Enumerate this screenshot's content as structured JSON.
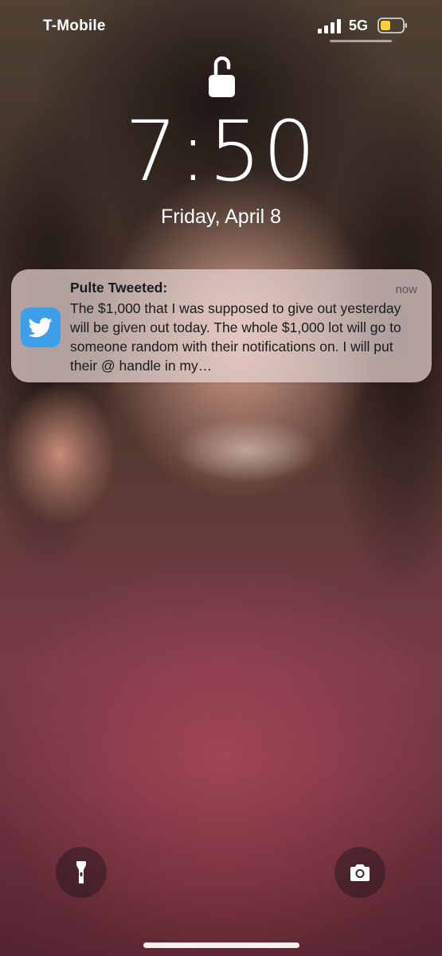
{
  "status_bar": {
    "carrier": "T-Mobile",
    "network": "5G",
    "signal_icon": "signal-bars-icon",
    "battery_icon": "battery-low-icon",
    "battery_color": "#f4d03f"
  },
  "lock_screen": {
    "lock_icon": "unlocked-padlock-icon",
    "time": "7:50",
    "date": "Friday, April 8"
  },
  "notification": {
    "app_icon": "twitter-bird-icon",
    "app_color": "#3c9fe8",
    "title": "Pulte Tweeted:",
    "time": "now",
    "body": "The $1,000 that I was supposed to give out yesterday will be given out today. The whole $1,000 lot will go to someone random with their notifications on. I will put their @ handle in my…"
  },
  "quick_actions": {
    "left_icon": "flashlight-icon",
    "right_icon": "camera-icon"
  }
}
